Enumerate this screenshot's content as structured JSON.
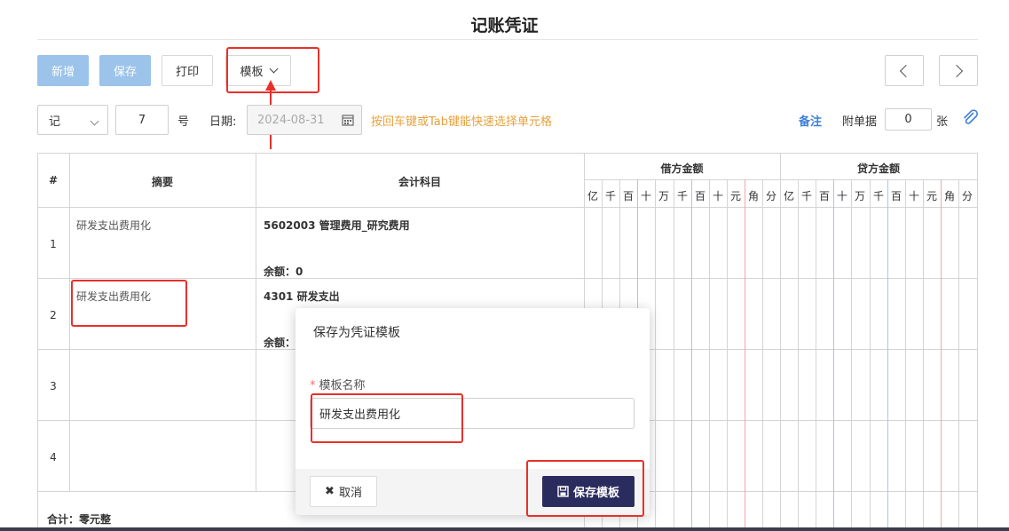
{
  "page": {
    "title": "记账凭证"
  },
  "toolbar": {
    "new_label": "新增",
    "save_label": "保存",
    "print_label": "打印",
    "template_label": "模板"
  },
  "voucher": {
    "word": "记",
    "number": "7",
    "number_suffix": "号",
    "date_label": "日期:",
    "date_value": "2024-08-31",
    "hint": "按回车键或Tab键能快速选择单元格",
    "note_label": "备注",
    "attach_label": "附单据",
    "attach_count": "0",
    "attach_unit": "张"
  },
  "table": {
    "col_num": "#",
    "col_summary": "摘要",
    "col_account": "会计科目",
    "col_debit": "借方金额",
    "col_credit": "贷方金额",
    "units": [
      "亿",
      "千",
      "百",
      "十",
      "万",
      "千",
      "百",
      "十",
      "元",
      "角",
      "分"
    ],
    "rows": [
      {
        "num": "1",
        "summary": "研发支出费用化",
        "account": "5602003 管理费用_研究费用",
        "balance": "余额：0"
      },
      {
        "num": "2",
        "summary": "研发支出费用化",
        "account": "4301 研发支出",
        "balance": "余额："
      },
      {
        "num": "3",
        "summary": "",
        "account": "",
        "balance": ""
      },
      {
        "num": "4",
        "summary": "",
        "account": "",
        "balance": ""
      }
    ],
    "total_label": "合计：零元整"
  },
  "modal": {
    "title": "保存为凭证模板",
    "required_mark": "*",
    "field_label": "模板名称",
    "field_value": "研发支出费用化",
    "cancel_label": "取消",
    "save_label": "保存模板"
  },
  "colors": {
    "accent": "#2b2c5e",
    "annotation": "#e8302a",
    "hint": "#e6a23c",
    "link": "#3d7fd8"
  }
}
